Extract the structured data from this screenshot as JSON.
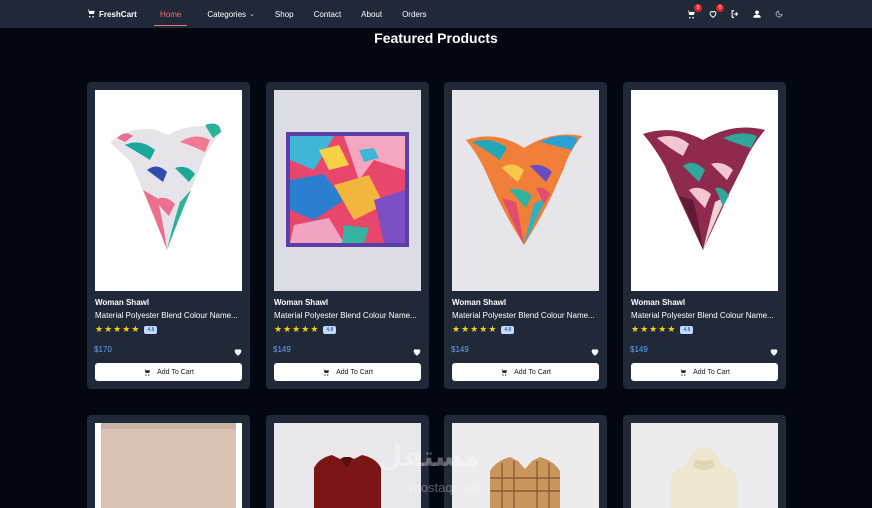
{
  "brand": {
    "name": "FreshCart",
    "icon": "cart-icon"
  },
  "nav": {
    "links": [
      {
        "label": "Home",
        "active": true
      },
      {
        "label": "Categories",
        "dropdown": true
      },
      {
        "label": "Shop"
      },
      {
        "label": "Contact"
      },
      {
        "label": "About"
      },
      {
        "label": "Orders"
      }
    ],
    "cart_count": "0",
    "wishlist_count": "0",
    "icons": [
      "cart-icon",
      "heart-icon",
      "logout-icon",
      "user-icon",
      "theme-toggle-icon"
    ]
  },
  "section": {
    "title": "Featured Products"
  },
  "products": [
    {
      "title": "Woman Shawl",
      "desc": "Material Polyester Blend Colour Name...",
      "rating": "4.8",
      "price": "$170",
      "button": "Add To Cart"
    },
    {
      "title": "Woman Shawl",
      "desc": "Material Polyester Blend Colour Name...",
      "rating": "4.8",
      "price": "$149",
      "button": "Add To Cart"
    },
    {
      "title": "Woman Shawl",
      "desc": "Material Polyester Blend Colour Name...",
      "rating": "4.8",
      "price": "$149",
      "button": "Add To Cart"
    },
    {
      "title": "Woman Shawl",
      "desc": "Material Polyester Blend Colour Name...",
      "rating": "4.8",
      "price": "$149",
      "button": "Add To Cart"
    }
  ],
  "watermark": {
    "arabic": "مستقل",
    "latin": "mostaql.com"
  },
  "colors": {
    "accent": "#f87171",
    "price": "#60a5fa",
    "star": "#facc15",
    "card": "#1f2937",
    "background": "#030712"
  }
}
